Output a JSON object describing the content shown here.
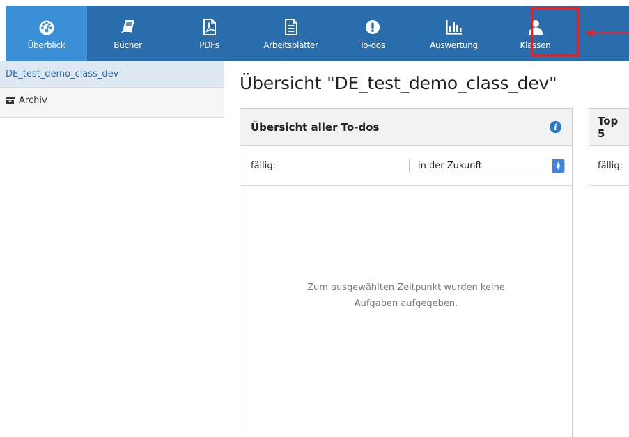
{
  "nav": {
    "items": [
      {
        "label": "Überblick",
        "icon": "dashboard-icon",
        "active": true
      },
      {
        "label": "Bücher",
        "icon": "book-icon",
        "active": false
      },
      {
        "label": "PDFs",
        "icon": "pdf-icon",
        "active": false
      },
      {
        "label": "Arbeitsblätter",
        "icon": "worksheet-icon",
        "active": false
      },
      {
        "label": "To-dos",
        "icon": "exclamation-icon",
        "active": false
      },
      {
        "label": "Auswertung",
        "icon": "bar-chart-icon",
        "active": false
      },
      {
        "label": "Klassen",
        "icon": "user-icon",
        "active": false
      }
    ],
    "highlight_color": "#d9262a"
  },
  "sidebar": {
    "class_item": "DE_test_demo_class_dev",
    "archive_label": "Archiv"
  },
  "main": {
    "title": "Übersicht \"DE_test_demo_class_dev\""
  },
  "todo_panel": {
    "title": "Übersicht aller To-dos",
    "filter_label": "fällig:",
    "filter_value": "in der Zukunft",
    "empty_line1": "Zum ausgewählten Zeitpunkt wurden keine",
    "empty_line2": "Aufgaben aufgegeben."
  },
  "top_panel": {
    "title": "Top 5",
    "filter_label": "fällig:"
  },
  "colors": {
    "nav_bg": "#2a6dad",
    "nav_active": "#3a8fd6"
  }
}
